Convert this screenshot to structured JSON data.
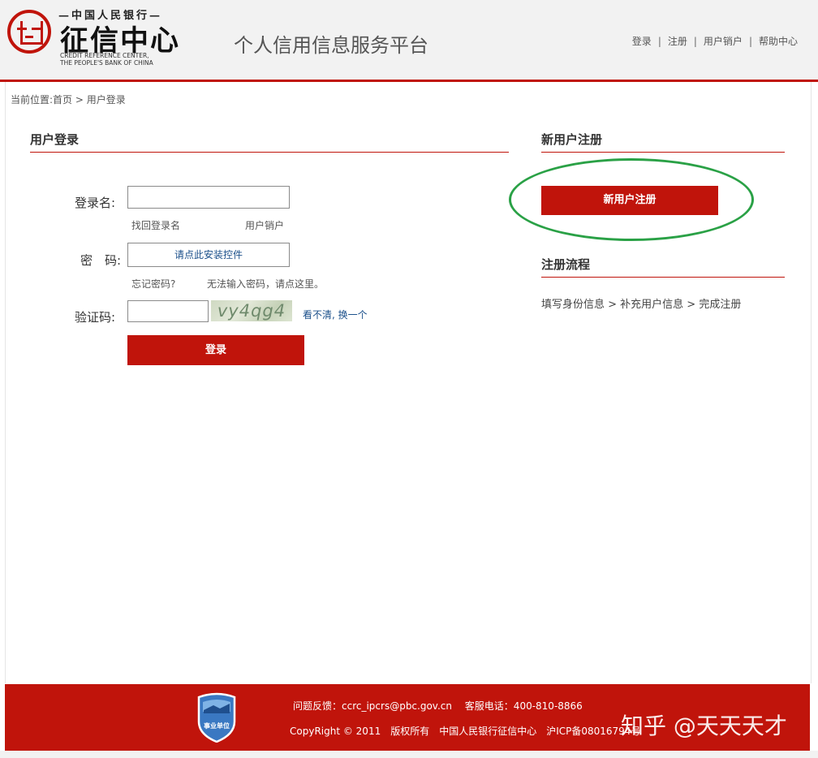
{
  "logo": {
    "top_text": "—中国人民银行—",
    "main_text": "征信中心",
    "en_line1": "CREDIT REFERENCE CENTER,",
    "en_line2": "THE PEOPLE'S BANK OF CHINA"
  },
  "header": {
    "platform_title": "个人信用信息服务平台",
    "nav": [
      "登录",
      "注册",
      "用户销户",
      "帮助中心"
    ],
    "nav_sep": "|"
  },
  "breadcrumb": {
    "prefix": "当前位置:",
    "home": "首页",
    "sep": " > ",
    "current": "用户登录"
  },
  "login": {
    "title": "用户登录",
    "username_label": "登录名:",
    "username_value": "",
    "find_username": "找回登录名",
    "cancel_account": "用户销户",
    "password_label": "密　码:",
    "install_control": "请点此安装控件",
    "forgot_password": "忘记密码?",
    "cannot_input": "无法输入密码，请点这里。",
    "captcha_label": "验证码:",
    "captcha_value": "",
    "captcha_image_text": "vy4qg4",
    "captcha_unclear": "看不清,",
    "captcha_refresh": "换一个",
    "submit_label": "登录"
  },
  "register": {
    "title": "新用户注册",
    "button_label": "新用户注册",
    "flow_title": "注册流程",
    "flow_text": "填写身份信息 > 补充用户信息 > 完成注册"
  },
  "footer": {
    "badge_text": "事业单位",
    "feedback": "问题反馈：ccrc_ipcrs@pbc.gov.cn　 客服电话：400-810-8866",
    "copyright": "CopyRight © 2011　版权所有　中国人民银行征信中心　沪ICP备08016794号"
  },
  "watermark": "知乎 @天天天才",
  "colors": {
    "brand_red": "#c0140b",
    "highlight_green": "#2aa146",
    "link_blue": "#1a4f8a"
  }
}
